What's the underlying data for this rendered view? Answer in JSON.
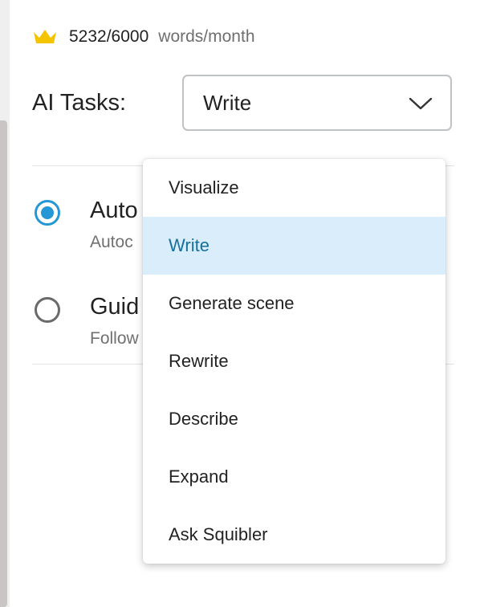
{
  "usage": {
    "count": "5232/6000",
    "unit": "words/month",
    "icon": "crown-icon",
    "icon_color": "#f5c400"
  },
  "tasks": {
    "label": "AI Tasks:",
    "selected": "Write"
  },
  "options": [
    {
      "title": "Auto",
      "description": "Autoc",
      "checked": true
    },
    {
      "title": "Guid",
      "description": "Follow",
      "checked": false
    }
  ],
  "menu": {
    "items": [
      {
        "label": "Visualize",
        "selected": false
      },
      {
        "label": "Write",
        "selected": true
      },
      {
        "label": "Generate scene",
        "selected": false
      },
      {
        "label": "Rewrite",
        "selected": false
      },
      {
        "label": "Describe",
        "selected": false
      },
      {
        "label": "Expand",
        "selected": false
      },
      {
        "label": "Ask Squibler",
        "selected": false
      }
    ]
  },
  "colors": {
    "accent": "#2596d6",
    "selected_bg": "#d9edfb",
    "selected_text": "#15709e"
  }
}
